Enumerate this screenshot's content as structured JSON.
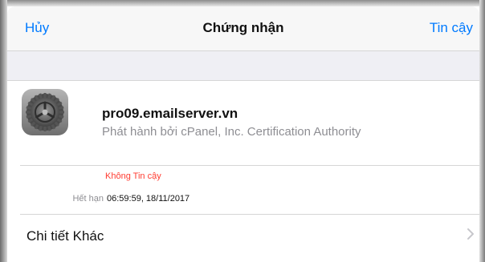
{
  "navbar": {
    "cancel_label": "Hủy",
    "title": "Chứng nhận",
    "trust_label": "Tin cậy"
  },
  "certificate": {
    "icon": "settings-gear-icon",
    "name": "pro09.emailserver.vn",
    "issued_by": "Phát hành bởi cPanel, Inc. Certification Authority",
    "trust_status": "Không Tin cậy",
    "trust_status_color": "#ff3b30",
    "expires_label": "Hết hạn",
    "expires_value": "06:59:59, 18/11/2017"
  },
  "more_details": {
    "label": "Chi tiết Khác",
    "icon": "chevron-right-icon"
  },
  "colors": {
    "accent": "#007aff",
    "secondary_text": "#8e8e93",
    "separator": "#d6d6d6",
    "group_background": "#efeff4"
  }
}
